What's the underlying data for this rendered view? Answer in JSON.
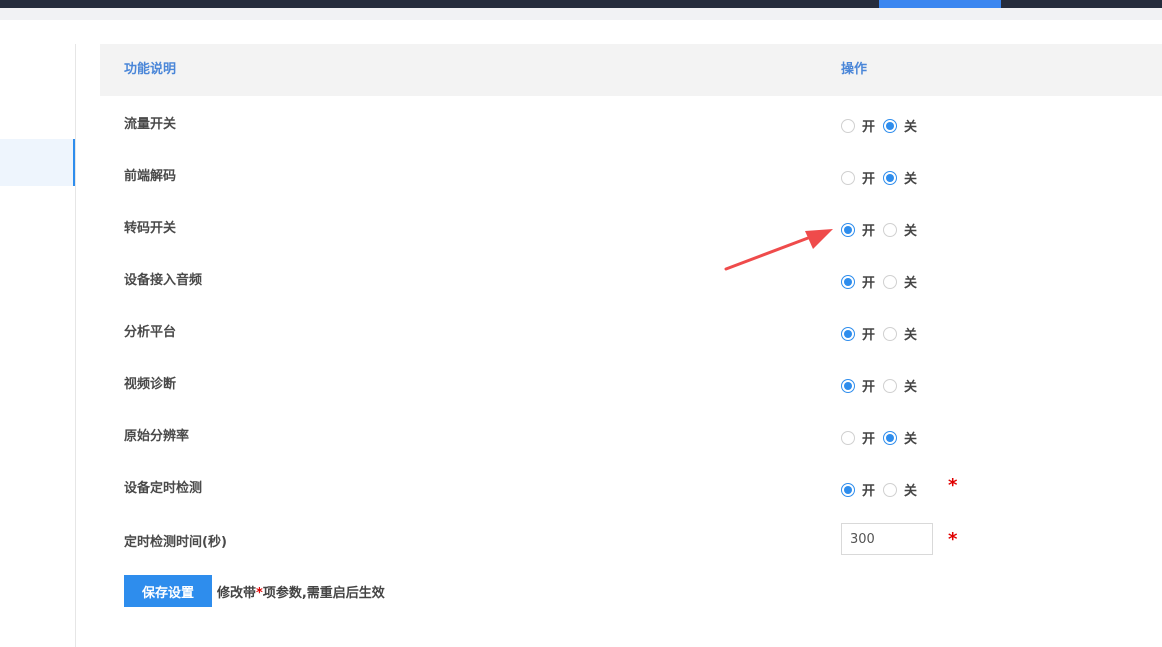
{
  "header": {
    "col_desc": "功能说明",
    "col_op": "操作"
  },
  "options": {
    "on": "开",
    "off": "关"
  },
  "rows": [
    {
      "label": "流量开关",
      "value": "off"
    },
    {
      "label": "前端解码",
      "value": "off"
    },
    {
      "label": "转码开关",
      "value": "on"
    },
    {
      "label": "设备接入音频",
      "value": "on"
    },
    {
      "label": "分析平台",
      "value": "on"
    },
    {
      "label": "视频诊断",
      "value": "on"
    },
    {
      "label": "原始分辨率",
      "value": "off"
    },
    {
      "label": "设备定时检测",
      "value": "on",
      "required": true
    }
  ],
  "timer": {
    "label": "定时检测时间(秒)",
    "value": "300",
    "required": true
  },
  "required_mark": "*",
  "footer": {
    "save_label": "保存设置",
    "note_before": "修改带",
    "note_star": "*",
    "note_after": "项参数,需重启后生效"
  },
  "colors": {
    "accent": "#2e8ded",
    "required": "#e00000",
    "annotation_arrow": "#ef4b4b"
  }
}
